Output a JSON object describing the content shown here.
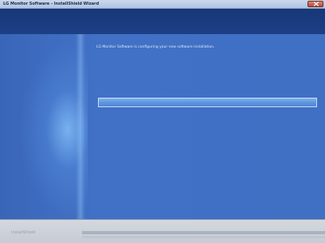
{
  "window": {
    "title": "LG Monitor Software - InstallShield Wizard"
  },
  "main": {
    "status_message": "LG Monitor Software is configuring your new software installation.",
    "progress": 1.0
  },
  "footer": {
    "brand": "InstallShield"
  },
  "colors": {
    "header_band": "#173777",
    "body": "#4070c4",
    "progress_fill": "#6aa0e6",
    "footer": "#cfd3da"
  },
  "icons": {
    "close": "close-icon"
  }
}
